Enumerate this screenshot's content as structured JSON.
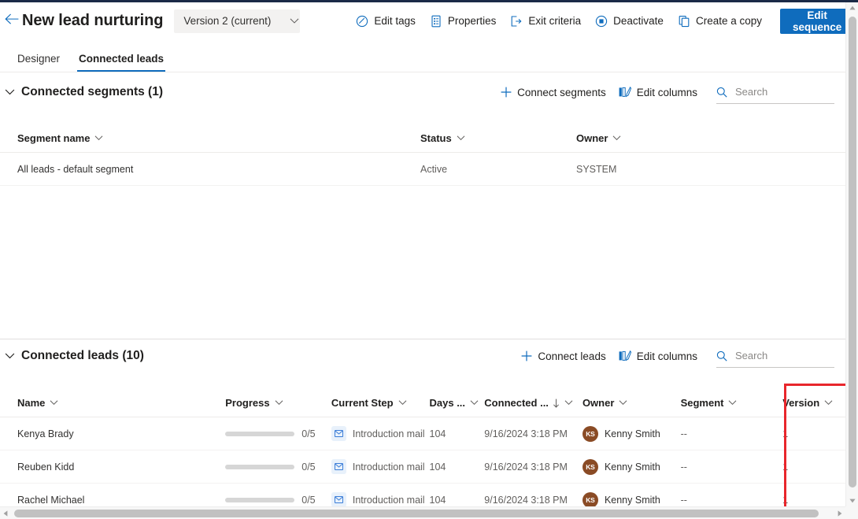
{
  "header": {
    "back_icon": "arrow-left-icon",
    "title": "New lead nurturing",
    "version_selector": {
      "label": "Version 2 (current)",
      "chevron_icon": "chevron-down-icon"
    },
    "actions": [
      {
        "label": "Edit tags",
        "icon": "tag-icon"
      },
      {
        "label": "Properties",
        "icon": "document-properties-icon"
      },
      {
        "label": "Exit criteria",
        "icon": "exit-icon"
      },
      {
        "label": "Deactivate",
        "icon": "stop-circle-icon"
      },
      {
        "label": "Create a copy",
        "icon": "copy-icon"
      }
    ],
    "primary_button": "Edit sequence"
  },
  "tabs": [
    {
      "label": "Designer",
      "active": false
    },
    {
      "label": "Connected leads",
      "active": true
    }
  ],
  "segments_section": {
    "title": "Connected segments (1)",
    "collapse_icon": "chevron-down-icon",
    "tools": [
      {
        "label": "Connect segments",
        "icon": "plus-icon"
      },
      {
        "label": "Edit columns",
        "icon": "edit-columns-icon"
      }
    ],
    "search": {
      "placeholder": "Search",
      "value": "",
      "icon": "search-icon"
    },
    "columns": [
      {
        "label": "Segment name",
        "chevron": "chevron-down-icon"
      },
      {
        "label": "Status",
        "chevron": "chevron-down-icon"
      },
      {
        "label": "Owner",
        "chevron": "chevron-down-icon"
      }
    ],
    "rows": [
      {
        "segment_name": "All leads - default segment",
        "status": "Active",
        "owner": "SYSTEM"
      }
    ]
  },
  "leads_section": {
    "title": "Connected leads (10)",
    "collapse_icon": "chevron-down-icon",
    "tools": [
      {
        "label": "Connect leads",
        "icon": "plus-icon"
      },
      {
        "label": "Edit columns",
        "icon": "edit-columns-icon"
      }
    ],
    "search": {
      "placeholder": "Search",
      "value": "",
      "icon": "search-icon"
    },
    "columns": [
      {
        "label": "Name",
        "chevron": "chevron-down-icon",
        "sorted": false
      },
      {
        "label": "Progress",
        "chevron": "chevron-down-icon",
        "sorted": false
      },
      {
        "label": "Current Step",
        "chevron": "chevron-down-icon",
        "sorted": false
      },
      {
        "label": "Days ...",
        "chevron": "chevron-down-icon",
        "sorted": false
      },
      {
        "label": "Connected ...",
        "chevron": "chevron-down-icon",
        "sorted": true,
        "sort_icon": "sort-descending-arrow-icon"
      },
      {
        "label": "Owner",
        "chevron": "chevron-down-icon",
        "sorted": false
      },
      {
        "label": "Segment",
        "chevron": "chevron-down-icon",
        "sorted": false
      },
      {
        "label": "Version",
        "chevron": "chevron-down-icon",
        "sorted": false
      }
    ],
    "rows": [
      {
        "name": "Kenya Brady",
        "progress_text": "0/5",
        "progress_value": 0,
        "progress_total": 5,
        "current_step": "Introduction mail",
        "step_icon": "envelope-icon",
        "days": "104",
        "connected": "9/16/2024 3:18 PM",
        "owner": "Kenny Smith",
        "owner_initials": "KS",
        "segment": "--",
        "version": "1"
      },
      {
        "name": "Reuben Kidd",
        "progress_text": "0/5",
        "progress_value": 0,
        "progress_total": 5,
        "current_step": "Introduction mail",
        "step_icon": "envelope-icon",
        "days": "104",
        "connected": "9/16/2024 3:18 PM",
        "owner": "Kenny Smith",
        "owner_initials": "KS",
        "segment": "--",
        "version": "1"
      },
      {
        "name": "Rachel Michael",
        "progress_text": "0/5",
        "progress_value": 0,
        "progress_total": 5,
        "current_step": "Introduction mail",
        "step_icon": "envelope-icon",
        "days": "104",
        "connected": "9/16/2024 3:18 PM",
        "owner": "Kenny Smith",
        "owner_initials": "KS",
        "segment": "--",
        "version": "1"
      }
    ]
  },
  "annotation": {
    "highlight_color": "#e8262c",
    "target": "Version column"
  },
  "colors": {
    "accent": "#0f6cbd",
    "primary_button_bg": "#0f6cbd",
    "avatar_bg": "#8a4b25",
    "highlight_red": "#e8262c",
    "top_strip": "#1b2a47"
  }
}
